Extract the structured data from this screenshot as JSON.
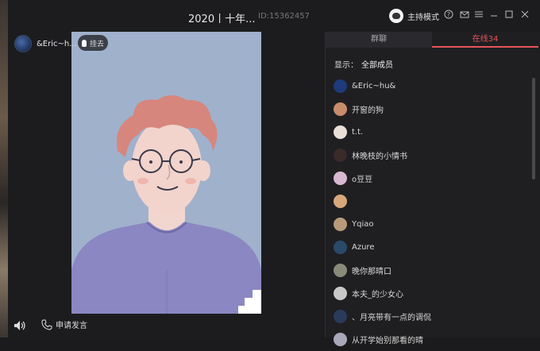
{
  "window": {
    "title": "2020丨十年...",
    "room_id": "ID:15362457",
    "host_label": "主持模式",
    "controls": [
      "help-icon",
      "mail-icon",
      "menu-icon",
      "minimize-icon",
      "maximize-icon",
      "close-icon"
    ]
  },
  "stage": {
    "speaker_name": "&Eric~h...",
    "hangup_label": "挂去"
  },
  "bottom_bar": {
    "apply_mic_label": "申请发言"
  },
  "sidebar": {
    "tabs": [
      {
        "label": "群聊",
        "active": false
      },
      {
        "label": "在线34",
        "active": true
      }
    ],
    "filter_label": "显示：",
    "filter_value": "全部成员",
    "members": [
      {
        "name": "&Eric~hu&",
        "avatar_color": "#1e3a7a"
      },
      {
        "name": "开窗的狗",
        "avatar_color": "#c98c6a"
      },
      {
        "name": "t.t.",
        "avatar_color": "#e8e0d8"
      },
      {
        "name": "林晚枝的小情书",
        "avatar_color": "#3a2a2a"
      },
      {
        "name": "o豆豆",
        "avatar_color": "#d8b8d0"
      },
      {
        "name": "",
        "avatar_color": "#d8a87a"
      },
      {
        "name": "Yqiao",
        "avatar_color": "#b89a7a"
      },
      {
        "name": "Azure",
        "avatar_color": "#2a4a6a"
      },
      {
        "name": "晚你那晴口",
        "avatar_color": "#8a8a7a"
      },
      {
        "name": "本夫_的少女心",
        "avatar_color": "#c8c8c8"
      },
      {
        "name": "、月亮带有一点的调侃",
        "avatar_color": "#2a3a5a"
      },
      {
        "name": "从开学始别那看的晴",
        "avatar_color": "#a8a8b8"
      }
    ]
  },
  "colors": {
    "accent": "#e8545a",
    "video_background": "#a0b1cc"
  }
}
